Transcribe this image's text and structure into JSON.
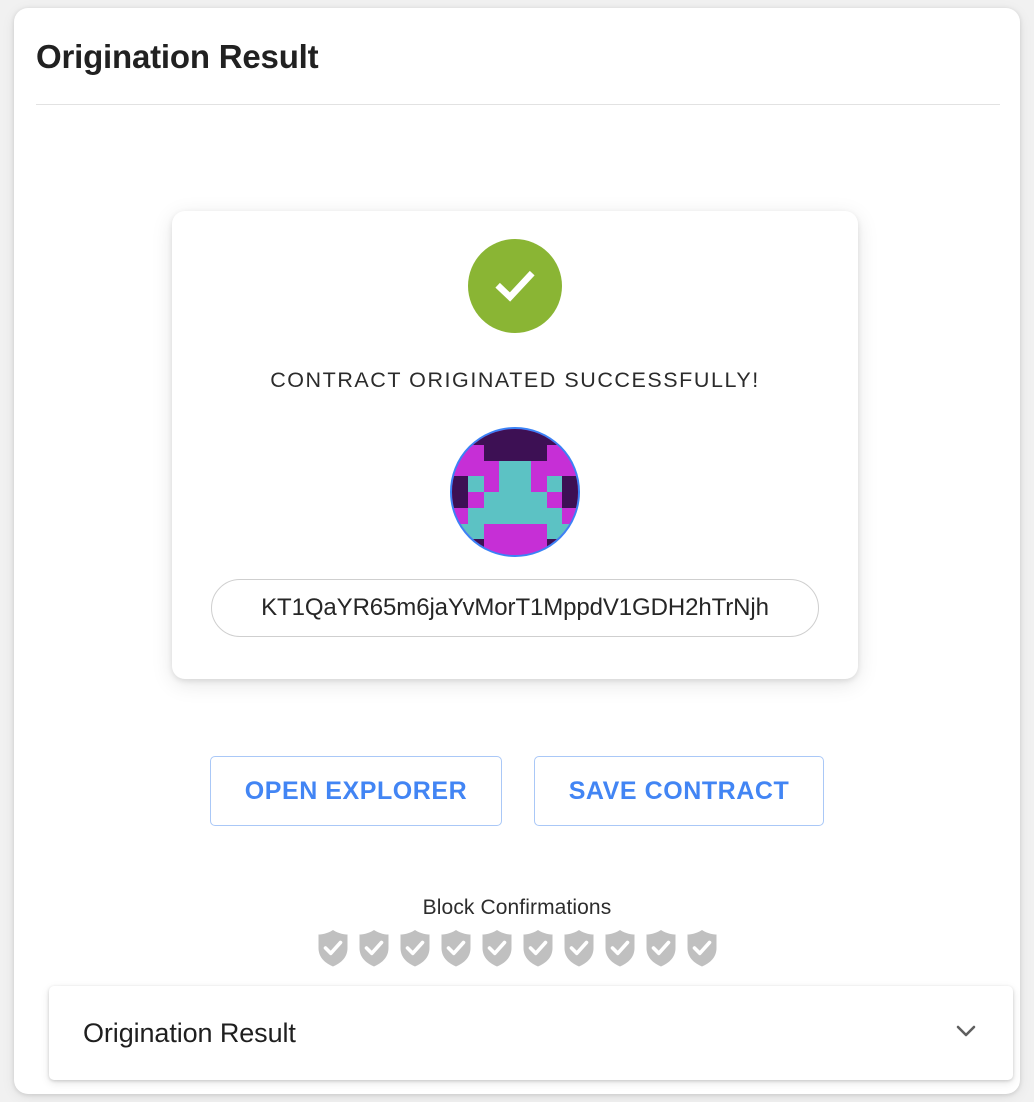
{
  "header": {
    "title": "Origination Result"
  },
  "success_card": {
    "status_icon": "check-circle-icon",
    "status_color": "#8ab534",
    "message": "CONTRACT ORIGINATED SUCCESSFULLY!",
    "identicon": {
      "name": "contract-identicon",
      "ring_color": "#3b82f6",
      "colors": {
        "magenta": "#c62fd6",
        "teal": "#5cc2c4",
        "purple": "#3d1054"
      },
      "grid": [
        [
          "purple",
          "purple",
          "purple",
          "purple",
          "purple",
          "purple",
          "purple",
          "purple"
        ],
        [
          "magenta",
          "magenta",
          "purple",
          "purple",
          "purple",
          "purple",
          "magenta",
          "magenta"
        ],
        [
          "magenta",
          "magenta",
          "magenta",
          "teal",
          "teal",
          "magenta",
          "magenta",
          "magenta"
        ],
        [
          "purple",
          "teal",
          "magenta",
          "teal",
          "teal",
          "magenta",
          "teal",
          "purple"
        ],
        [
          "purple",
          "magenta",
          "teal",
          "teal",
          "teal",
          "teal",
          "magenta",
          "purple"
        ],
        [
          "magenta",
          "teal",
          "teal",
          "teal",
          "teal",
          "teal",
          "teal",
          "magenta"
        ],
        [
          "teal",
          "teal",
          "magenta",
          "magenta",
          "magenta",
          "magenta",
          "teal",
          "teal"
        ],
        [
          "teal",
          "purple",
          "magenta",
          "magenta",
          "magenta",
          "magenta",
          "purple",
          "teal"
        ]
      ]
    },
    "address": "KT1QaYR65m6jaYvMorT1MppdV1GDH2hTrNjh"
  },
  "actions": {
    "open_explorer_label": "OPEN EXPLORER",
    "save_contract_label": "SAVE CONTRACT",
    "accent_color": "#4285f4"
  },
  "confirmations": {
    "label": "Block Confirmations",
    "count": 10,
    "shield_color": "#c0c0c0",
    "shields": [
      {
        "name": "confirmation-shield-1",
        "confirmed": true
      },
      {
        "name": "confirmation-shield-2",
        "confirmed": true
      },
      {
        "name": "confirmation-shield-3",
        "confirmed": true
      },
      {
        "name": "confirmation-shield-4",
        "confirmed": true
      },
      {
        "name": "confirmation-shield-5",
        "confirmed": true
      },
      {
        "name": "confirmation-shield-6",
        "confirmed": true
      },
      {
        "name": "confirmation-shield-7",
        "confirmed": true
      },
      {
        "name": "confirmation-shield-8",
        "confirmed": true
      },
      {
        "name": "confirmation-shield-9",
        "confirmed": true
      },
      {
        "name": "confirmation-shield-10",
        "confirmed": true
      }
    ]
  },
  "accordion": {
    "title": "Origination Result",
    "expand_icon": "chevron-down-icon",
    "expanded": false
  }
}
